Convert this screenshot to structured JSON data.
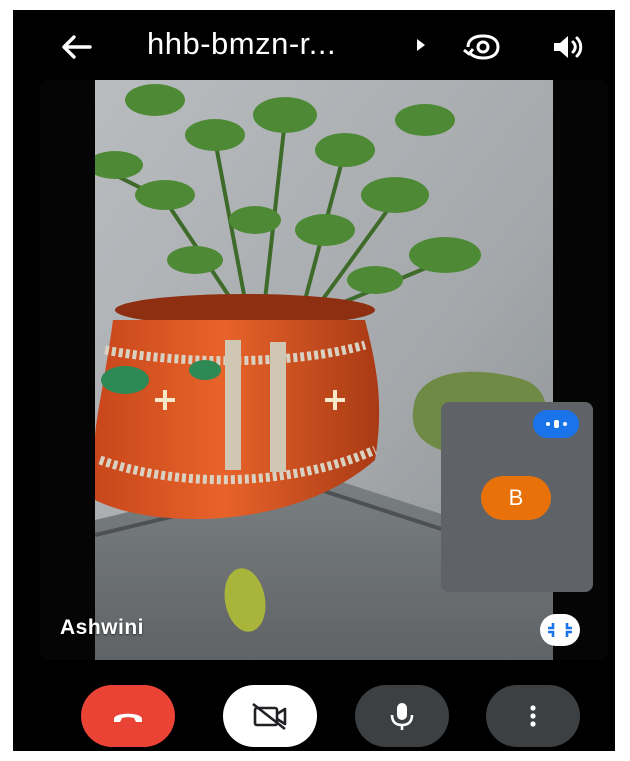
{
  "header": {
    "title": "hhb-bmzn-r...",
    "back_icon": "arrow-left-icon",
    "dropdown_icon": "caret-right-icon",
    "switch_camera_icon": "switch-camera-icon",
    "speaker_icon": "speaker-icon"
  },
  "video": {
    "participant_name": "Ashwini",
    "self_view": {
      "avatar_letter": "B",
      "avatar_color": "#e8710a",
      "badge_icon": "speaking-indicator-icon",
      "badge_color": "#1a73e8"
    },
    "minimize_icon": "collapse-icon"
  },
  "controls": {
    "end_call": {
      "icon": "call-end-icon",
      "color": "#ea4335"
    },
    "camera": {
      "icon": "videocam-off-icon",
      "color": "#ffffff"
    },
    "mic": {
      "icon": "mic-icon",
      "color": "#3c4043"
    },
    "more": {
      "icon": "more-vert-icon",
      "color": "#3c4043"
    }
  }
}
